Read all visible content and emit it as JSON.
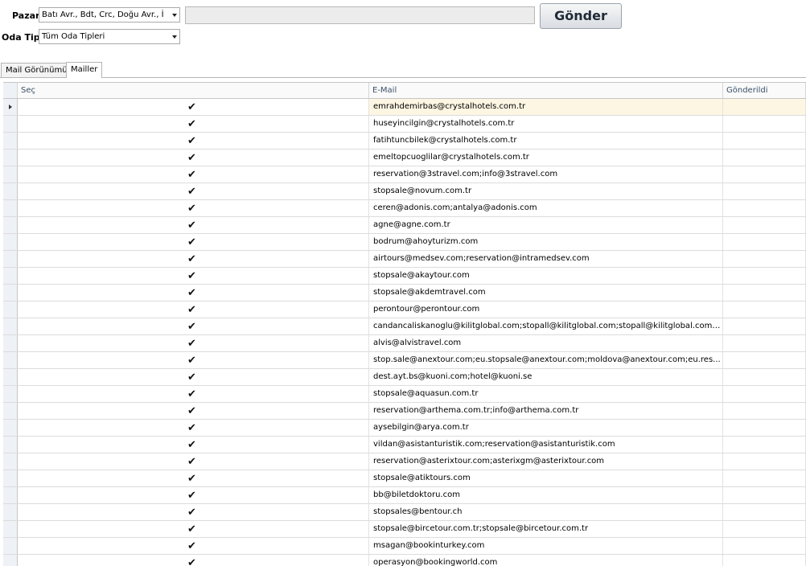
{
  "filters": {
    "pazar_label": "Pazar",
    "pazar_value": "Batı Avr., Bdt, Crc, Doğu Avr., İ",
    "oda_tipi_label": "Oda Tipi",
    "oda_tipi_value": "Tüm Oda Tipleri",
    "message_value": "",
    "send_label": "Gönder"
  },
  "tabs": [
    {
      "label": "Mail Görünümü",
      "active": false
    },
    {
      "label": "Mailler",
      "active": true
    }
  ],
  "grid": {
    "columns": [
      "Seç",
      "E-Mail",
      "Gönderildi"
    ],
    "check_icon": "✔",
    "rows": [
      {
        "checked": true,
        "email": "emrahdemirbas@crystalhotels.com.tr",
        "sent": ""
      },
      {
        "checked": true,
        "email": "huseyincilgin@crystalhotels.com.tr",
        "sent": ""
      },
      {
        "checked": true,
        "email": "fatihtuncbilek@crystalhotels.com.tr",
        "sent": ""
      },
      {
        "checked": true,
        "email": "emeltopcuoglilar@crystalhotels.com.tr",
        "sent": ""
      },
      {
        "checked": true,
        "email": "reservation@3stravel.com;info@3stravel.com",
        "sent": ""
      },
      {
        "checked": true,
        "email": "stopsale@novum.com.tr",
        "sent": ""
      },
      {
        "checked": true,
        "email": "ceren@adonis.com;antalya@adonis.com",
        "sent": ""
      },
      {
        "checked": true,
        "email": "agne@agne.com.tr",
        "sent": ""
      },
      {
        "checked": true,
        "email": "bodrum@ahoyturizm.com",
        "sent": ""
      },
      {
        "checked": true,
        "email": "airtours@medsev.com;reservation@intramedsev.com",
        "sent": ""
      },
      {
        "checked": true,
        "email": "stopsale@akaytour.com",
        "sent": ""
      },
      {
        "checked": true,
        "email": "stopsale@akdemtravel.com",
        "sent": ""
      },
      {
        "checked": true,
        "email": "perontour@perontour.com",
        "sent": ""
      },
      {
        "checked": true,
        "email": "candancaliskanoglu@kilitglobal.com;stopall@kilitglobal.com;stopall@kilitglobal.com;stop...",
        "sent": ""
      },
      {
        "checked": true,
        "email": "alvis@alvistravel.com",
        "sent": ""
      },
      {
        "checked": true,
        "email": "stop.sale@anextour.com;eu.stopsale@anextour.com;moldova@anextour.com;eu.res...",
        "sent": ""
      },
      {
        "checked": true,
        "email": "dest.ayt.bs@kuoni.com;hotel@kuoni.se",
        "sent": ""
      },
      {
        "checked": true,
        "email": "stopsale@aquasun.com.tr",
        "sent": ""
      },
      {
        "checked": true,
        "email": "reservation@arthema.com.tr;info@arthema.com.tr",
        "sent": ""
      },
      {
        "checked": true,
        "email": "aysebilgin@arya.com.tr",
        "sent": ""
      },
      {
        "checked": true,
        "email": "vildan@asistanturistik.com;reservation@asistanturistik.com",
        "sent": ""
      },
      {
        "checked": true,
        "email": "reservation@asterixtour.com;asterixgm@asterixtour.com",
        "sent": ""
      },
      {
        "checked": true,
        "email": "stopsale@atiktours.com",
        "sent": ""
      },
      {
        "checked": true,
        "email": "bb@biletdoktoru.com",
        "sent": ""
      },
      {
        "checked": true,
        "email": "stopsales@bentour.ch",
        "sent": ""
      },
      {
        "checked": true,
        "email": "stopsale@bircetour.com.tr;stopsale@bircetour.com.tr",
        "sent": ""
      },
      {
        "checked": true,
        "email": "msagan@bookinturkey.com",
        "sent": ""
      },
      {
        "checked": true,
        "email": "operasyon@bookingworld.com",
        "sent": ""
      }
    ]
  }
}
